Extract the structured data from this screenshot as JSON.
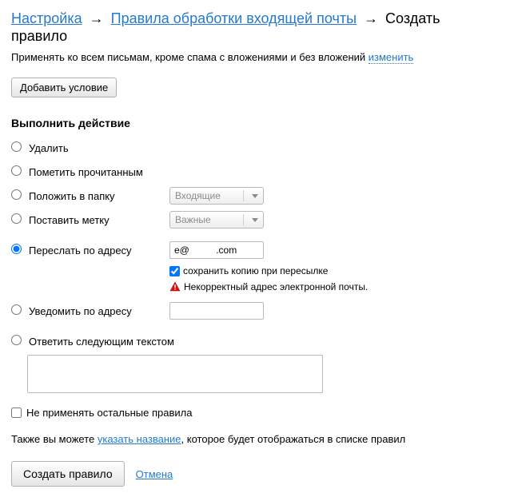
{
  "breadcrumb": {
    "settings": "Настройка",
    "rules": "Правила обработки входящей почты",
    "create": "Создать правило"
  },
  "apply": {
    "text": "Применять ко всем письмам, кроме спама с вложениями и без вложений ",
    "change": "изменить"
  },
  "add_condition": "Добавить условие",
  "section_title": "Выполнить действие",
  "actions": {
    "delete": "Удалить",
    "mark_read": "Пометить прочитанным",
    "move_folder": "Положить в папку",
    "set_label": "Поставить метку",
    "forward": "Переслать по адресу",
    "notify": "Уведомить по адресу",
    "reply": "Ответить следующим текстом"
  },
  "selects": {
    "folder": "Входящие",
    "label": "Важные"
  },
  "forward": {
    "value": "e@          .com",
    "keep_copy": "сохранить копию при пересылке",
    "error": "Некорректный адрес электронной почты."
  },
  "notify_value": "",
  "no_other_rules": "Не применять остальные правила",
  "also": {
    "pre": "Также вы можете ",
    "link": "указать название",
    "post": ", которое будет отображаться в списке правил"
  },
  "submit": "Создать правило",
  "cancel": "Отмена"
}
